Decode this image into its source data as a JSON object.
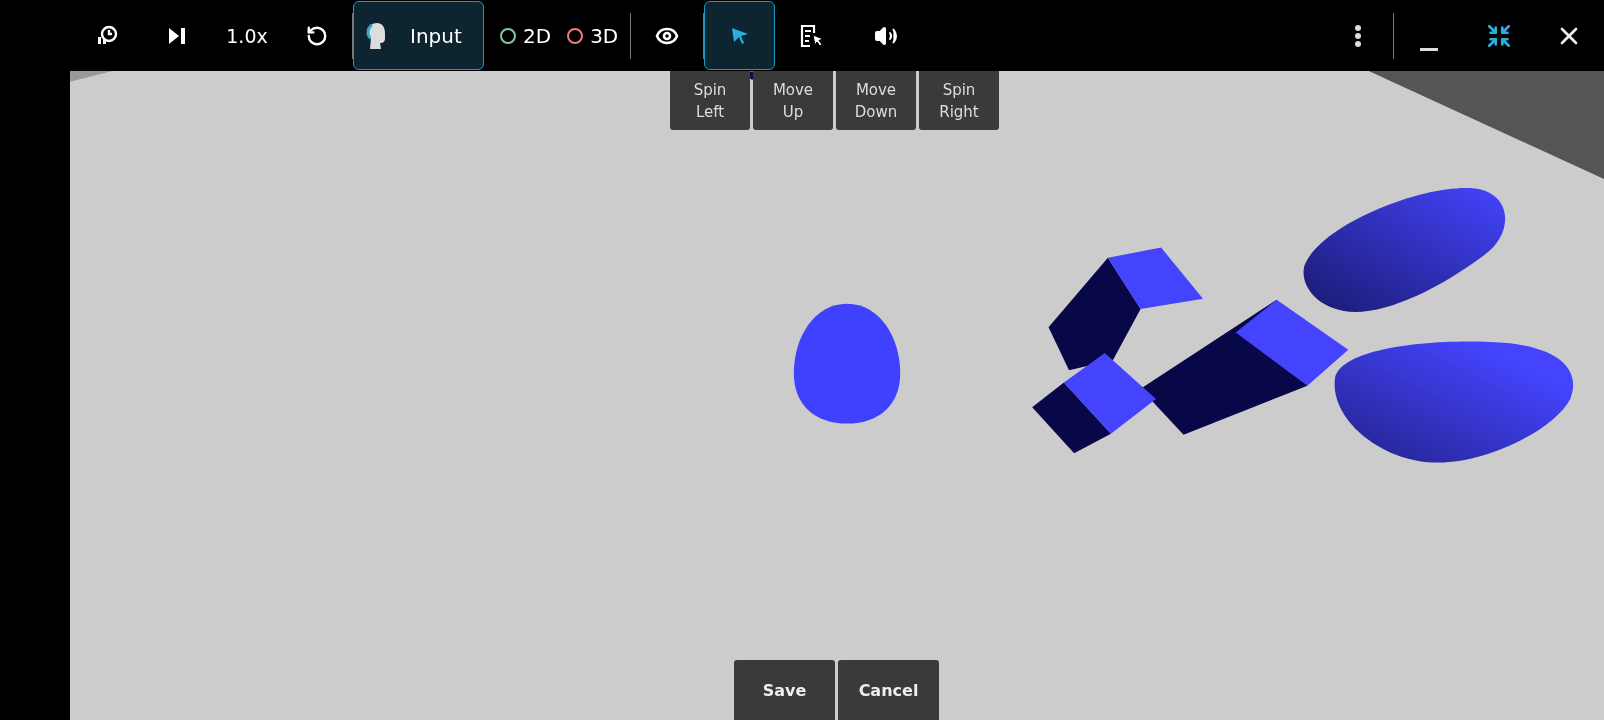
{
  "toolbar": {
    "speed": "1.0x",
    "mode": {
      "label": "Input",
      "selected": true
    },
    "views": [
      {
        "label": "2D",
        "color": "#7fc8a0"
      },
      {
        "label": "3D",
        "color": "#f07878"
      }
    ],
    "tools": [
      {
        "kind": "pointer",
        "selected": true
      },
      {
        "kind": "form",
        "selected": false
      },
      {
        "kind": "sound",
        "selected": false
      }
    ]
  },
  "camera_controls": [
    "Spin Left",
    "Move Up",
    "Move Down",
    "Spin Right"
  ],
  "actions": [
    "Save",
    "Cancel"
  ]
}
